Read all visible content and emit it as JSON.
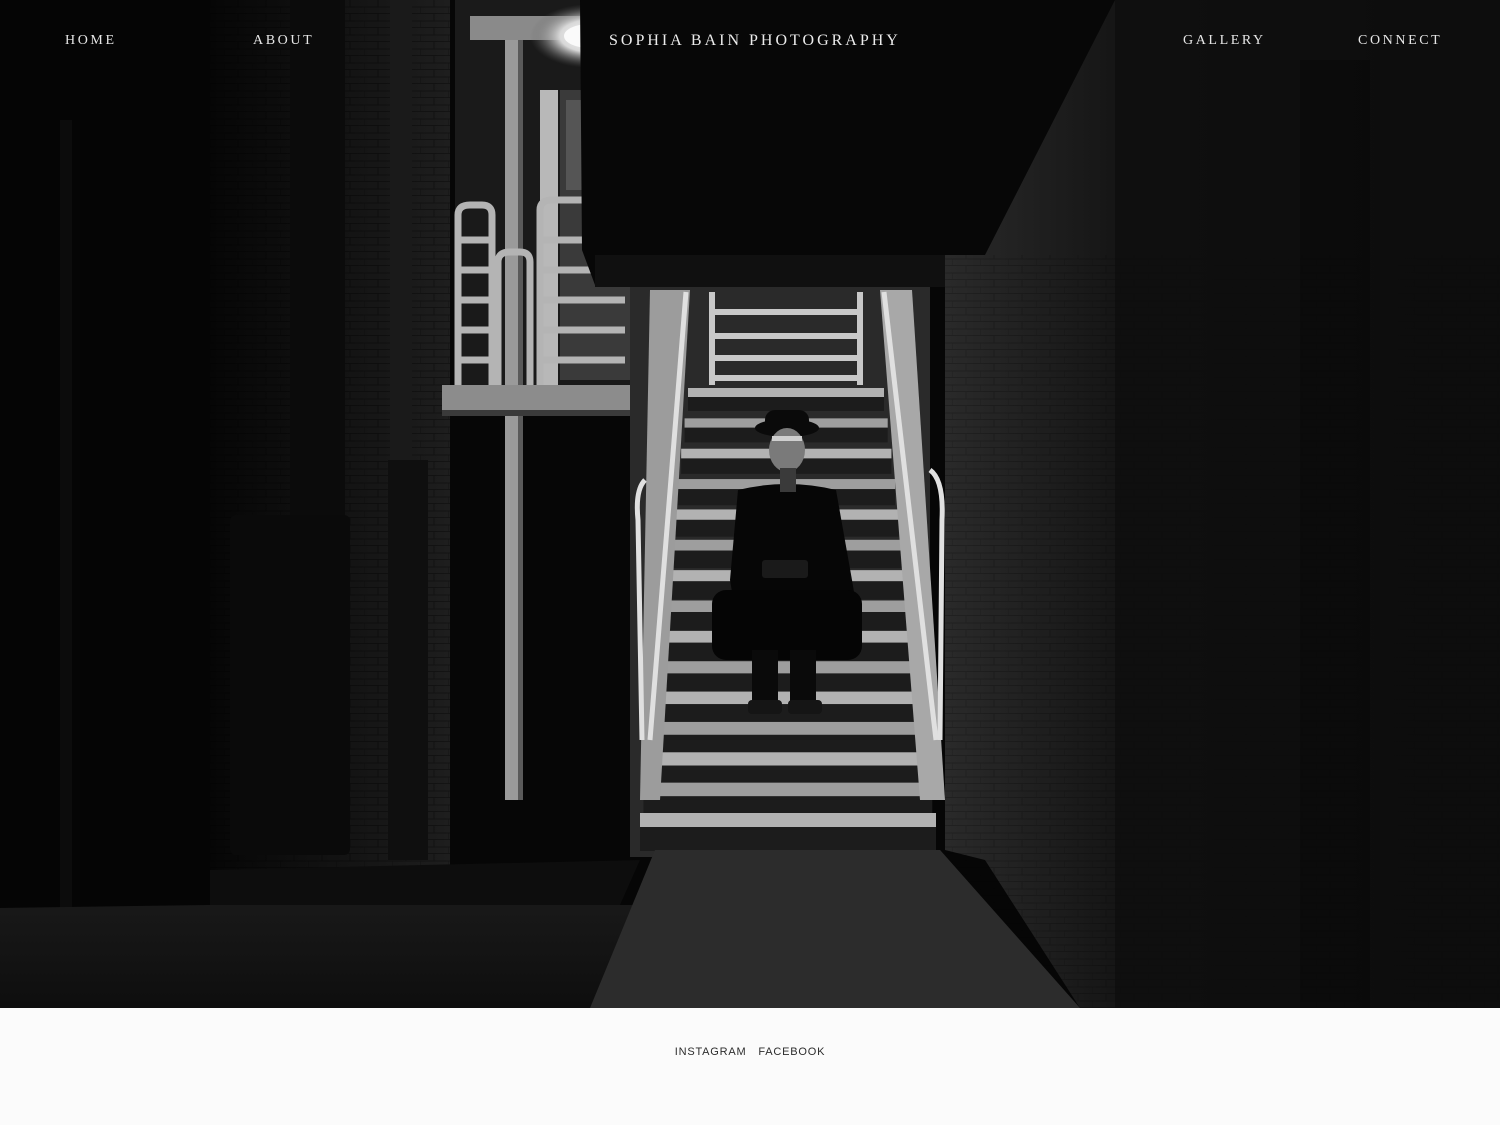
{
  "nav": {
    "home": "HOME",
    "about": "ABOUT",
    "brand": "SOPHIA BAIN PHOTOGRAPHY",
    "gallery": "GALLERY",
    "connect": "CONNECT"
  },
  "hero": {
    "image_subject": "person-sitting-on-stairs-night"
  },
  "footer": {
    "instagram": "INSTAGRAM",
    "facebook": "FACEBOOK"
  },
  "colors": {
    "background": "#050505",
    "footer_bg": "#fbfbfb",
    "nav_text": "#e6e6e6",
    "footer_text": "#2c2c2c"
  }
}
